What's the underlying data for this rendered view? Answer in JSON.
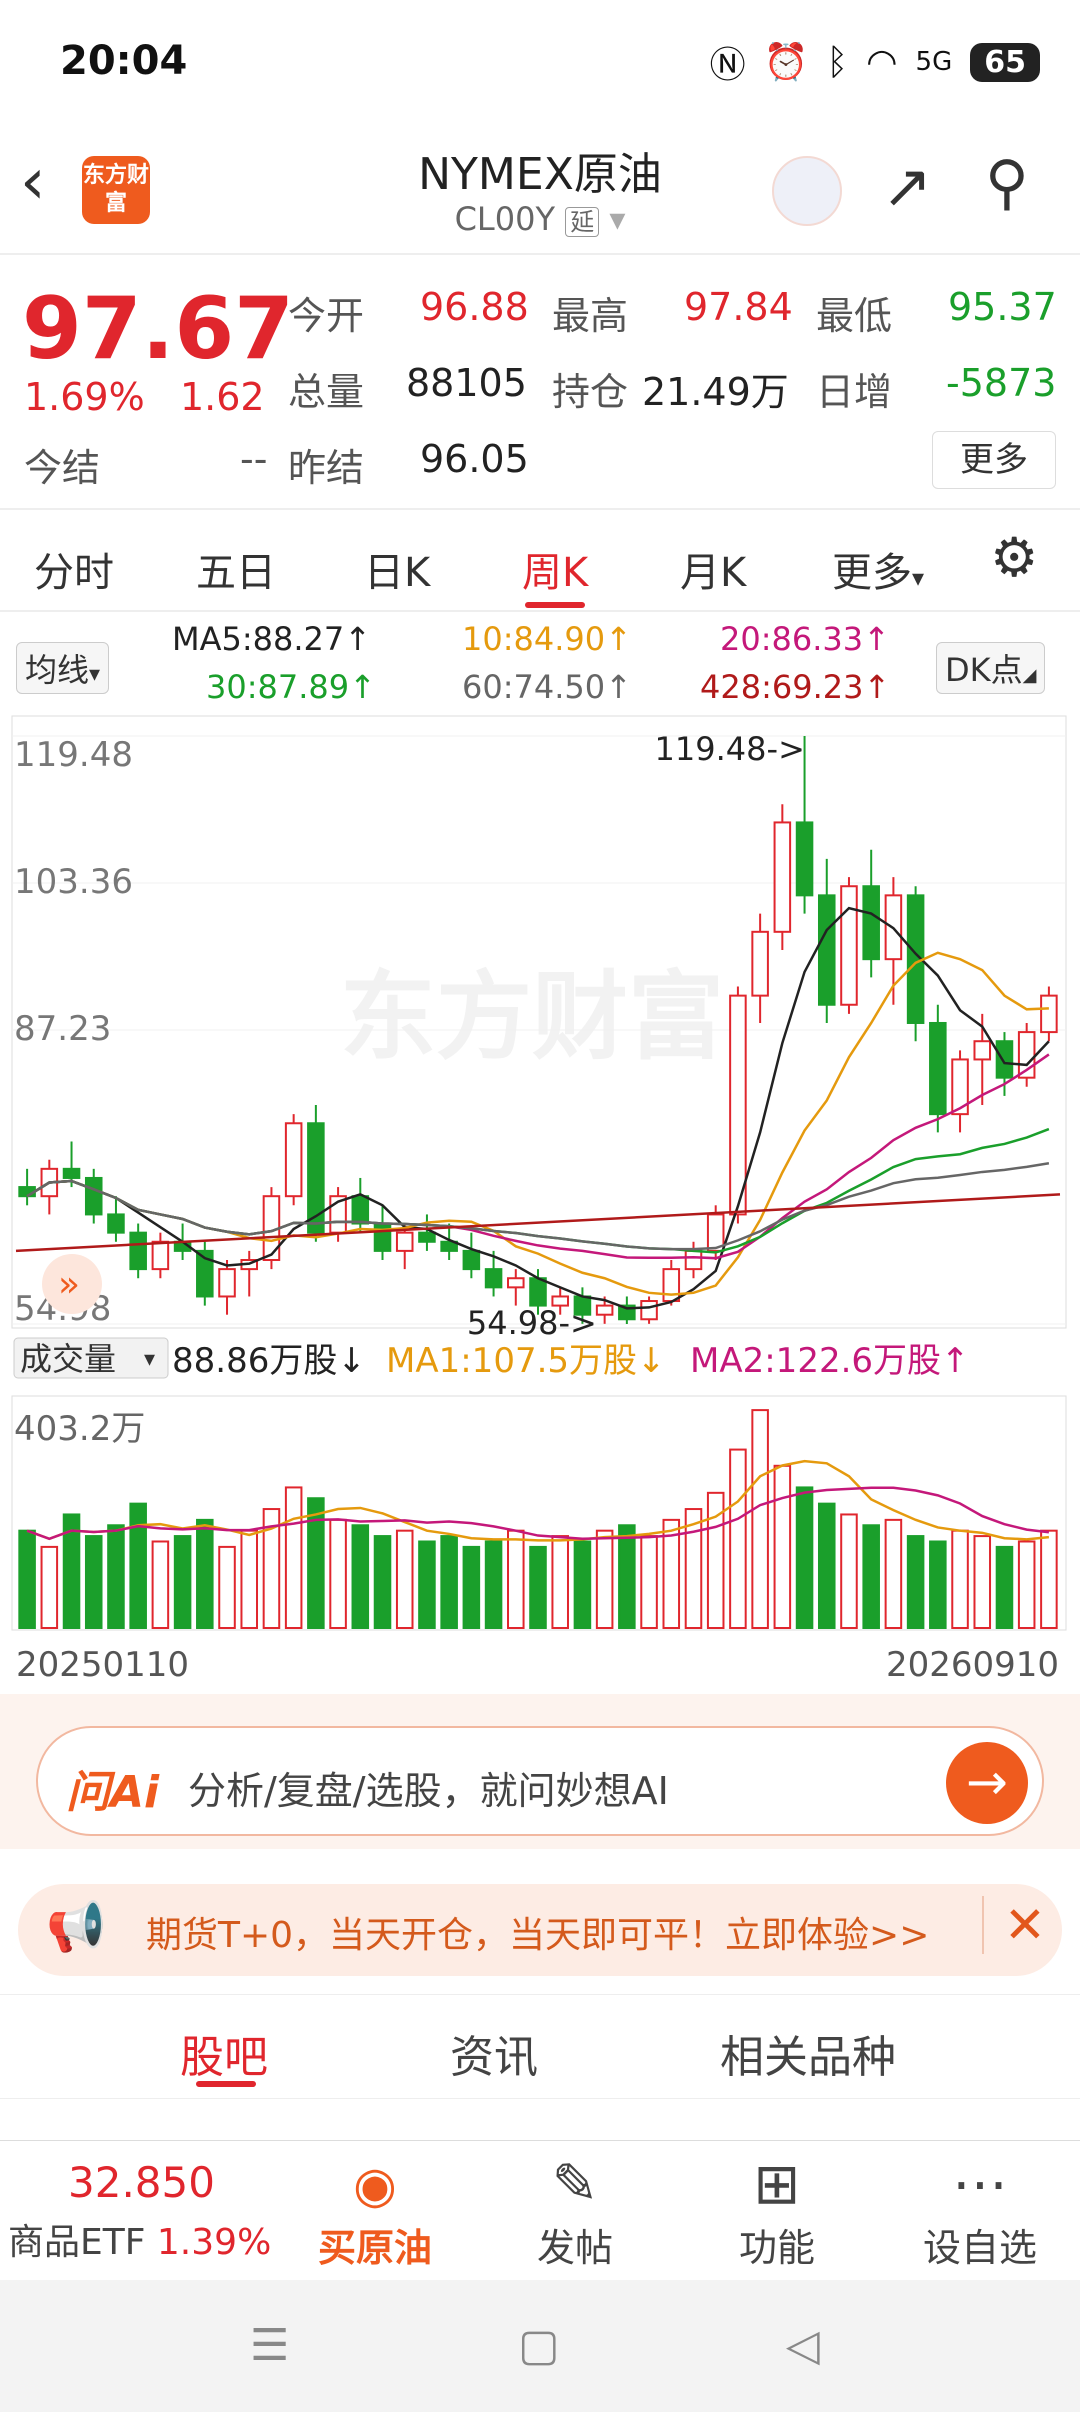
{
  "status": {
    "time": "20:04",
    "battery": "65",
    "signal": "5G"
  },
  "header": {
    "title": "NYMEX原油",
    "code": "CL00Y",
    "code_tag": "延",
    "logo_text": "东方财富"
  },
  "quote": {
    "price": "97.67",
    "pct": "1.69%",
    "change": "1.62",
    "open_label": "今开",
    "open": "96.88",
    "high_label": "最高",
    "high": "97.84",
    "low_label": "最低",
    "low": "95.37",
    "vol_label": "总量",
    "vol": "88105",
    "oi_label": "持仓",
    "oi": "21.49万",
    "inc_label": "日增",
    "inc": "-5873",
    "settle_label": "今结",
    "settle": "--",
    "prev_label": "昨结",
    "prev": "96.05",
    "more": "更多"
  },
  "tabs": [
    "分时",
    "五日",
    "日K",
    "周K",
    "月K",
    "更多"
  ],
  "ma_bar": {
    "selector": "均线",
    "ma5": "MA5:88.27↑",
    "ma10": "10:84.90↑",
    "ma20": "20:86.33↑",
    "ma30": "30:87.89↑",
    "ma60": "60:74.50↑",
    "ma428": "428:69.23↑",
    "dk": "DK点"
  },
  "chart_data": {
    "type": "candlestick",
    "ylabels": [
      "119.48",
      "103.36",
      "87.23",
      "54.98"
    ],
    "max_note": "119.48->",
    "min_note": "54.98->",
    "watermark": "东方财富",
    "x_start": "20250110",
    "x_end": "20260910",
    "candles": [
      [
        70,
        72,
        68,
        69
      ],
      [
        69,
        73,
        67,
        72
      ],
      [
        72,
        75,
        70,
        71
      ],
      [
        71,
        72,
        66,
        67
      ],
      [
        67,
        69,
        64,
        65
      ],
      [
        65,
        66,
        60,
        61
      ],
      [
        61,
        65,
        60,
        64
      ],
      [
        64,
        66,
        62,
        63
      ],
      [
        63,
        64,
        57,
        58
      ],
      [
        58,
        62,
        56,
        61
      ],
      [
        61,
        63,
        58,
        62
      ],
      [
        62,
        70,
        61,
        69
      ],
      [
        69,
        78,
        68,
        77
      ],
      [
        77,
        79,
        64,
        65
      ],
      [
        65,
        70,
        64,
        69
      ],
      [
        69,
        71,
        65,
        66
      ],
      [
        66,
        68,
        62,
        63
      ],
      [
        63,
        66,
        61,
        65
      ],
      [
        65,
        67,
        63,
        64
      ],
      [
        64,
        66,
        62,
        63
      ],
      [
        63,
        65,
        60,
        61
      ],
      [
        61,
        63,
        58,
        59
      ],
      [
        59,
        61,
        57,
        60
      ],
      [
        60,
        61,
        56,
        57
      ],
      [
        57,
        59,
        56,
        58
      ],
      [
        58,
        59,
        55,
        56
      ],
      [
        56,
        58,
        55,
        57
      ],
      [
        57,
        58,
        54.98,
        55.5
      ],
      [
        55.5,
        58,
        55,
        57.5
      ],
      [
        57.5,
        62,
        57,
        61
      ],
      [
        61,
        64,
        60,
        63
      ],
      [
        63,
        68,
        62,
        67
      ],
      [
        67,
        92,
        66,
        91
      ],
      [
        91,
        100,
        88,
        98
      ],
      [
        98,
        112,
        96,
        110
      ],
      [
        110,
        119.48,
        100,
        102
      ],
      [
        102,
        106,
        88,
        90
      ],
      [
        90,
        104,
        89,
        103
      ],
      [
        103,
        107,
        93,
        95
      ],
      [
        95,
        104,
        90,
        102
      ],
      [
        102,
        103,
        86,
        88
      ],
      [
        88,
        90,
        76,
        78
      ],
      [
        78,
        85,
        76,
        84
      ],
      [
        84,
        89,
        79,
        86
      ],
      [
        86,
        87,
        80,
        82
      ],
      [
        82,
        88,
        81,
        87
      ],
      [
        87,
        92,
        86,
        91
      ]
    ],
    "volume_label": "成交量",
    "volume_now": "88.86万股↓",
    "vol_ma1": "MA1:107.5万股↓",
    "vol_ma2": "MA2:122.6万股↑",
    "volume_max_label": "403.2万",
    "volumes": [
      180,
      150,
      210,
      170,
      190,
      230,
      160,
      170,
      200,
      150,
      180,
      220,
      260,
      240,
      200,
      190,
      170,
      180,
      160,
      170,
      150,
      160,
      180,
      150,
      170,
      160,
      180,
      190,
      170,
      200,
      220,
      250,
      330,
      403,
      300,
      260,
      230,
      210,
      190,
      200,
      170,
      160,
      180,
      170,
      150,
      160,
      180
    ]
  },
  "ai": {
    "logo": "问Ai",
    "text": "分析/复盘/选股，就问妙想AI"
  },
  "promo": {
    "text": "期货T+0，当天开仓，当天即可平！立即体验>>"
  },
  "subtabs": [
    "股吧",
    "资讯",
    "相关品种"
  ],
  "bottom": {
    "etf_price": "32.850",
    "etf_label": "商品ETF",
    "etf_pct": "1.39%",
    "buy": "买原油",
    "post": "发帖",
    "func": "功能",
    "fav": "设自选"
  },
  "colors": {
    "up": "#e0262d",
    "down": "#1a9f2b",
    "accent": "#ef5b1e"
  }
}
